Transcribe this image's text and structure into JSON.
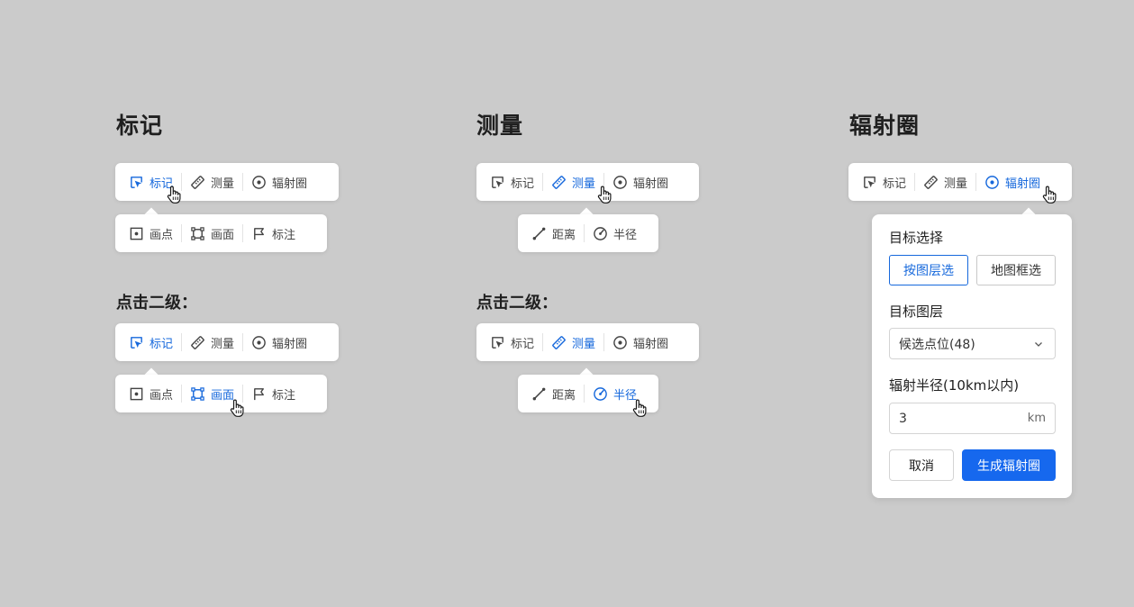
{
  "colors": {
    "accent": "#1668dc",
    "background": "#cbcbcb",
    "primary_button": "#1668ee"
  },
  "sections": {
    "mark": {
      "title": "标记"
    },
    "measure": {
      "title": "测量"
    },
    "radiation": {
      "title": "辐射圈"
    }
  },
  "sub_title": "点击二级：",
  "toolbar": {
    "mark": "标记",
    "measure": "测量",
    "radiation": "辐射圈"
  },
  "mark_submenu": {
    "point": "画点",
    "area": "画面",
    "annotate": "标注"
  },
  "measure_submenu": {
    "distance": "距离",
    "radius": "半径"
  },
  "icons": {
    "mark": "select-cursor-icon",
    "measure": "ruler-icon",
    "radiation": "target-circle-icon",
    "point": "dot-square-icon",
    "area": "polygon-square-icon",
    "annotate": "flag-icon",
    "distance": "line-measure-icon",
    "radius": "gauge-icon",
    "cursor": "hand-pointer-icon"
  },
  "radiation_panel": {
    "target_select_label": "目标选择",
    "by_layer": "按图层选",
    "by_map_box": "地图框选",
    "target_layer_label": "目标图层",
    "target_layer_value": "候选点位(48)",
    "radius_label": "辐射半径(10km以内)",
    "radius_value": "3",
    "radius_unit": "km",
    "cancel": "取消",
    "generate": "生成辐射圈"
  }
}
